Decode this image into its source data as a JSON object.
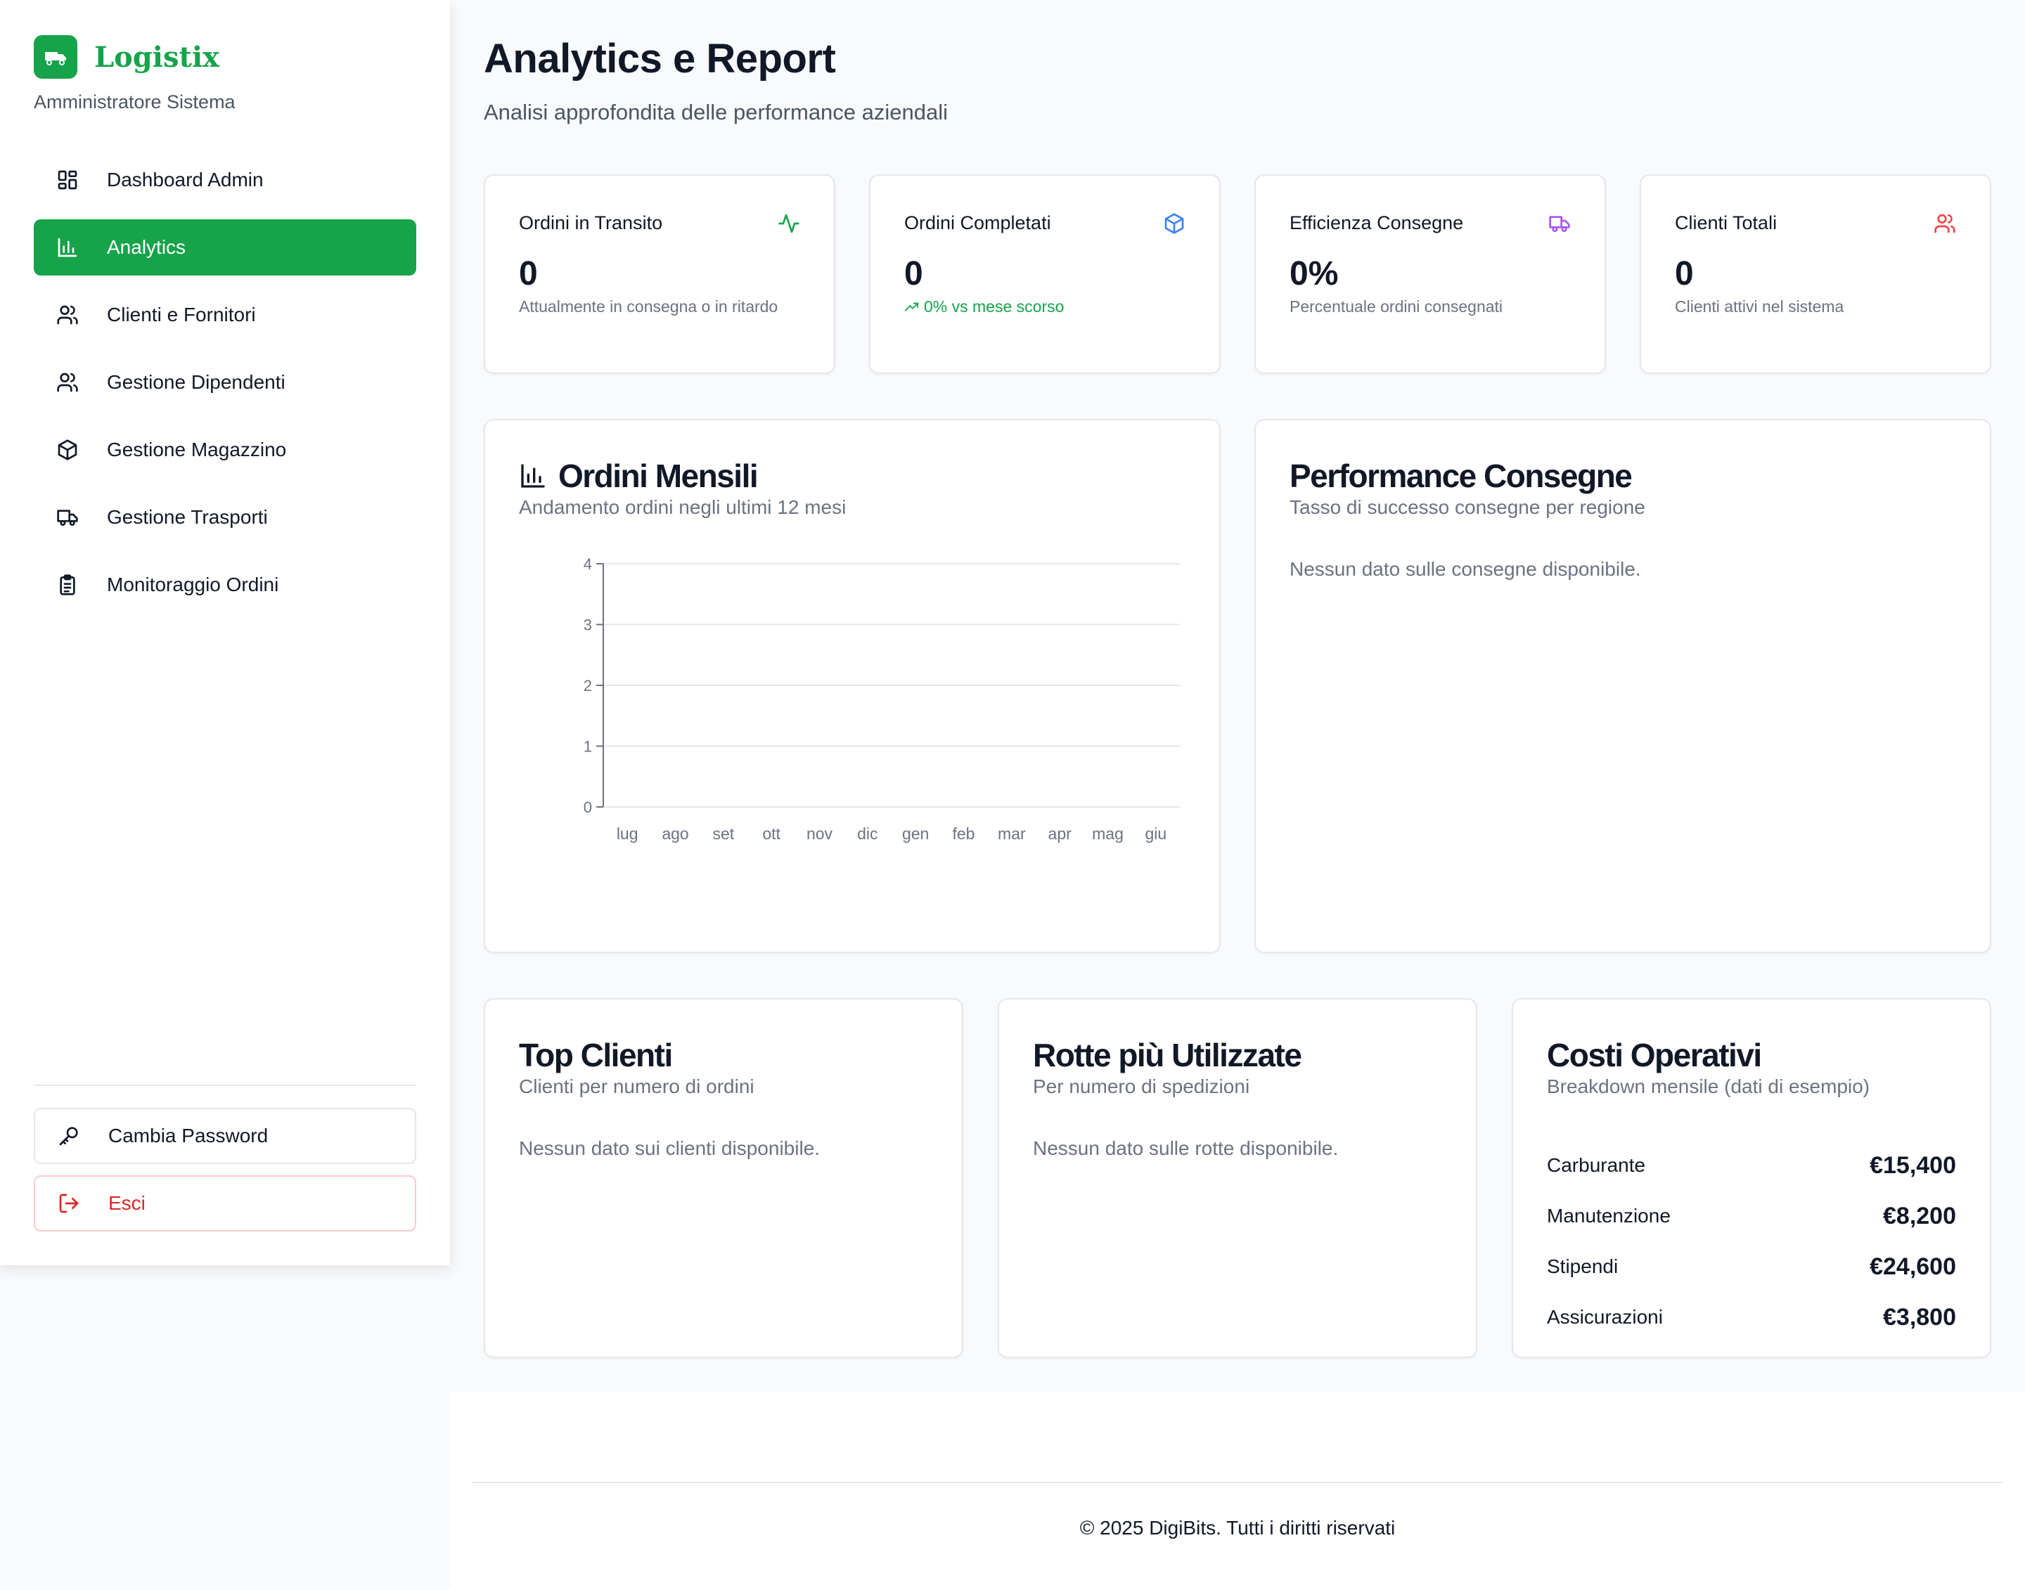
{
  "brand": {
    "name": "Logistix",
    "role": "Amministratore Sistema"
  },
  "nav": {
    "items": [
      {
        "label": "Dashboard Admin",
        "icon": "dashboard-icon"
      },
      {
        "label": "Analytics",
        "icon": "bar-chart-icon",
        "active": true
      },
      {
        "label": "Clienti e Fornitori",
        "icon": "users-icon"
      },
      {
        "label": "Gestione Dipendenti",
        "icon": "users-icon"
      },
      {
        "label": "Gestione Magazzino",
        "icon": "package-icon"
      },
      {
        "label": "Gestione Trasporti",
        "icon": "truck-icon"
      },
      {
        "label": "Monitoraggio Ordini",
        "icon": "clipboard-list-icon"
      }
    ],
    "change_password": "Cambia Password",
    "logout": "Esci"
  },
  "header": {
    "title": "Analytics e Report",
    "subtitle": "Analisi approfondita delle performance aziendali"
  },
  "stats": [
    {
      "title": "Ordini in Transito",
      "value": "0",
      "note": "Attualmente in consegna o in ritardo",
      "icon": "activity-icon",
      "color": "#16a34a"
    },
    {
      "title": "Ordini Completati",
      "value": "0",
      "note": "0% vs mese scorso",
      "icon": "package-icon",
      "color": "#3b82f6"
    },
    {
      "title": "Efficienza Consegne",
      "value": "0%",
      "note": "Percentuale ordini consegnati",
      "icon": "truck-icon",
      "color": "#a855f7"
    },
    {
      "title": "Clienti Totali",
      "value": "0",
      "note": "Clienti attivi nel sistema",
      "icon": "users-icon",
      "color": "#ef4444"
    }
  ],
  "monthly_orders": {
    "title": "Ordini Mensili",
    "subtitle": "Andamento ordini negli ultimi 12 mesi"
  },
  "chart_data": {
    "type": "bar",
    "categories": [
      "lug",
      "ago",
      "set",
      "ott",
      "nov",
      "dic",
      "gen",
      "feb",
      "mar",
      "apr",
      "mag",
      "giu"
    ],
    "values": [
      0,
      0,
      0,
      0,
      0,
      0,
      0,
      0,
      0,
      0,
      0,
      0
    ],
    "yticks": [
      "0",
      "1",
      "2",
      "3",
      "4"
    ],
    "ylim": [
      0,
      4
    ],
    "title": "Ordini Mensili",
    "grid": true
  },
  "delivery_performance": {
    "title": "Performance Consegne",
    "subtitle": "Tasso di successo consegne per regione",
    "empty": "Nessun dato sulle consegne disponibile."
  },
  "top_clients": {
    "title": "Top Clienti",
    "subtitle": "Clienti per numero di ordini",
    "empty": "Nessun dato sui clienti disponibile."
  },
  "top_routes": {
    "title": "Rotte più Utilizzate",
    "subtitle": "Per numero di spedizioni",
    "empty": "Nessun dato sulle rotte disponibile."
  },
  "costs": {
    "title": "Costi Operativi",
    "subtitle": "Breakdown mensile (dati di esempio)",
    "items": [
      {
        "label": "Carburante",
        "value": "€15,400"
      },
      {
        "label": "Manutenzione",
        "value": "€8,200"
      },
      {
        "label": "Stipendi",
        "value": "€24,600"
      },
      {
        "label": "Assicurazioni",
        "value": "€3,800"
      }
    ]
  },
  "footer": {
    "text": "© 2025 DigiBits. Tutti i diritti riservati"
  },
  "colors": {
    "accent": "#16a34a",
    "text": "#111827",
    "muted": "#6b7280"
  }
}
